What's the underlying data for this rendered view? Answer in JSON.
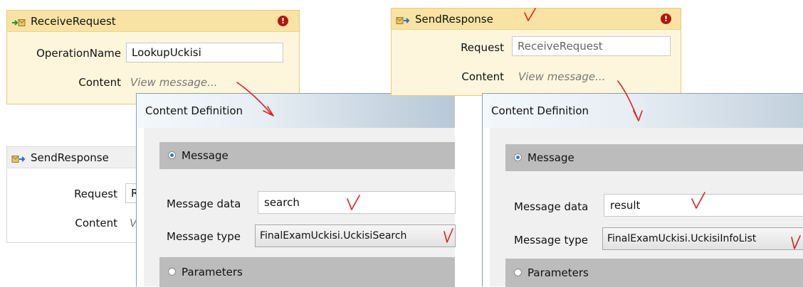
{
  "receive_request": {
    "title": "ReceiveRequest",
    "error_glyph": "!",
    "operation_label": "OperationName",
    "operation_value": "LookupUckisi",
    "content_label": "Content",
    "content_link": "View message..."
  },
  "send_response_left": {
    "title": "SendResponse",
    "request_label": "Request",
    "request_value": "R",
    "content_label": "Content",
    "content_value": "V"
  },
  "send_response_right": {
    "title": "SendResponse",
    "error_glyph": "!",
    "request_label": "Request",
    "request_value": "ReceiveRequest",
    "content_label": "Content",
    "content_link": "View message..."
  },
  "dialog_left": {
    "title": "Content Definition",
    "message_option": "Message",
    "message_data_label": "Message data",
    "message_data_value": "search",
    "message_type_label": "Message type",
    "message_type_value": "FinalExamUckisi.UckisiSearch",
    "parameters_option": "Parameters"
  },
  "dialog_right": {
    "title": "Content Definition",
    "message_option": "Message",
    "message_data_label": "Message data",
    "message_data_value": "result",
    "message_type_label": "Message type",
    "message_type_value": "FinalExamUckisi.UckisiInfoList",
    "parameters_option": "Parameters"
  },
  "colors": {
    "highlight_bg": "#fdf6dc",
    "highlight_border": "#e8cb7a",
    "highlight_header": "#f8e3a4",
    "error_red": "#b3150b",
    "annotation_red": "#e02020",
    "section_gray": "#bcbcbc",
    "dialog_frame": "#8aa0b4"
  },
  "icons": {
    "receive": "receive-activity-icon",
    "send": "send-activity-icon",
    "error": "error-icon",
    "annotation": "red-pen-annotation"
  }
}
